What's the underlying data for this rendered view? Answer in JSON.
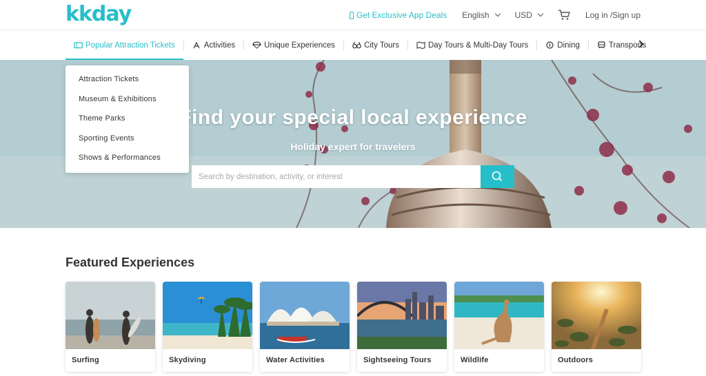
{
  "header": {
    "logo": "kkday",
    "app_deals": "Get Exclusive App Deals",
    "language": "English",
    "currency": "USD",
    "login": "Log in /Sign up"
  },
  "nav": {
    "items": [
      {
        "label": "Popular Attraction Tickets",
        "icon": "ticket-icon"
      },
      {
        "label": "Activities",
        "icon": "activity-icon"
      },
      {
        "label": "Unique Experiences",
        "icon": "parachute-icon"
      },
      {
        "label": "City Tours",
        "icon": "binoculars-icon"
      },
      {
        "label": "Day Tours & Multi-Day Tours",
        "icon": "map-icon"
      },
      {
        "label": "Dining",
        "icon": "dining-icon"
      },
      {
        "label": "Transports",
        "icon": "train-icon"
      }
    ]
  },
  "dropdown": {
    "items": [
      "Attraction Tickets",
      "Museum & Exhibitions",
      "Theme Parks",
      "Sporting Events",
      "Shows & Performances"
    ]
  },
  "hero": {
    "title": "Find your special local experience",
    "subtitle": "Holiday expert for travelers",
    "search_placeholder": "Search by destination, activity, or interest"
  },
  "featured": {
    "title": "Featured Experiences",
    "cards": [
      "Surfing",
      "Skydiving",
      "Water Activities",
      "Sightseeing Tours",
      "Wildlife",
      "Outdoors"
    ]
  },
  "colors": {
    "accent": "#26bec9"
  }
}
